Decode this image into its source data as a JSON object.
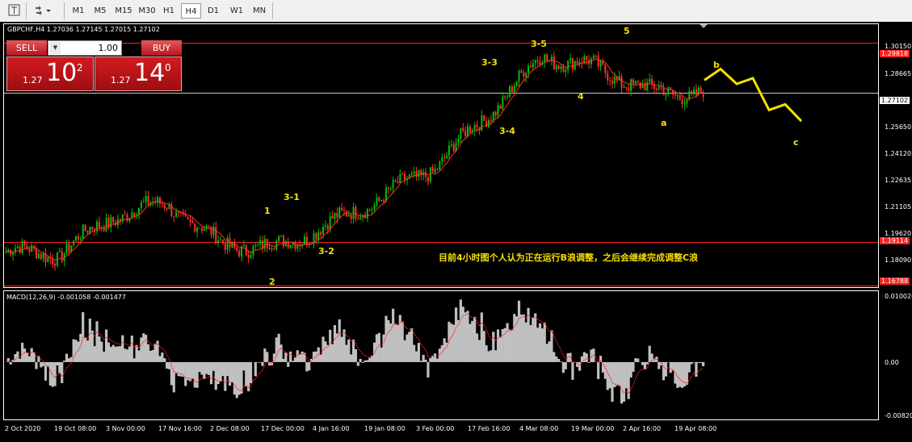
{
  "toolbar": {
    "timeframes": [
      "M1",
      "M5",
      "M15",
      "M30",
      "H1",
      "H4",
      "D1",
      "W1",
      "MN"
    ],
    "active_timeframe": "H4",
    "icons": [
      "crosshair-icon",
      "settings-icon"
    ]
  },
  "chart": {
    "header": "GBPCHF,H4  1.27036 1.27145 1.27015 1.27102",
    "macd_label": "MACD(12,26,9) -0.001058 -0.001477",
    "annotation": "目前4小时图个人认为正在运行B浪调整，之后会继续完成调整C浪",
    "colors": {
      "background": "#000000",
      "bull": "#00c000",
      "bear": "#ff3030",
      "wave": "#f5e000",
      "hline": "#ff2020",
      "macd_hist": "#c0c0c0",
      "macd_signal": "#ff2020"
    }
  },
  "trade": {
    "sell_label": "SELL",
    "buy_label": "BUY",
    "lot": "1.00",
    "sell_price_prefix": "1.27",
    "sell_price_big": "10",
    "sell_price_sup": "2",
    "buy_price_prefix": "1.27",
    "buy_price_big": "14",
    "buy_price_sup": "0"
  },
  "axis": {
    "prices": [
      "1.30150",
      "1.28665",
      "1.25650",
      "1.24120",
      "1.22635",
      "1.21105",
      "1.19620",
      "1.18090"
    ],
    "highlighted": {
      "upper_line": "1.29818",
      "current": "1.27102",
      "lower_line": "1.19114",
      "bottom_line": "1.16788"
    },
    "macd": [
      "0.010026",
      "0.00",
      "-0.00820"
    ],
    "times": [
      "2 Oct 2020",
      "19 Oct 08:00",
      "3 Nov 00:00",
      "17 Nov 16:00",
      "2 Dec 08:00",
      "17 Dec 00:00",
      "4 Jan 16:00",
      "19 Jan 08:00",
      "3 Feb 00:00",
      "17 Feb 16:00",
      "4 Mar 08:00",
      "19 Mar 00:00",
      "2 Apr 16:00",
      "19 Apr 08:00"
    ]
  },
  "waves": {
    "w1": "1",
    "w2": "2",
    "w31": "3-1",
    "w32": "3-2",
    "w33": "3-3",
    "w34": "3-4",
    "w35": "3-5",
    "w4": "4",
    "w5": "5",
    "wa": "a",
    "wb": "b",
    "wc": "c"
  },
  "chart_data": {
    "type": "candlestick",
    "symbol": "GBPCHF",
    "timeframe": "H4",
    "last": {
      "open": 1.27036,
      "high": 1.27145,
      "low": 1.27015,
      "close": 1.27102
    },
    "x": [
      "2 Oct 2020",
      "19 Oct",
      "3 Nov",
      "17 Nov",
      "2 Dec",
      "17 Dec",
      "4 Jan",
      "19 Jan",
      "3 Feb",
      "17 Feb",
      "4 Mar",
      "19 Mar",
      "2 Apr",
      "19 Apr"
    ],
    "close_approx": [
      1.186,
      1.185,
      1.205,
      1.212,
      1.19,
      1.188,
      1.2,
      1.215,
      1.232,
      1.26,
      1.291,
      1.285,
      1.272,
      1.271
    ],
    "ylim": [
      1.167,
      1.308
    ],
    "horizontal_lines": [
      1.29818,
      1.27102,
      1.19114,
      1.16788
    ],
    "projection_b_c": [
      1.278,
      1.284,
      1.276,
      1.279,
      1.262,
      1.265,
      1.256
    ],
    "macd": {
      "params": "12,26,9",
      "main": -0.001058,
      "signal": -0.001477,
      "ylim": [
        -0.0082,
        0.010026
      ]
    }
  }
}
